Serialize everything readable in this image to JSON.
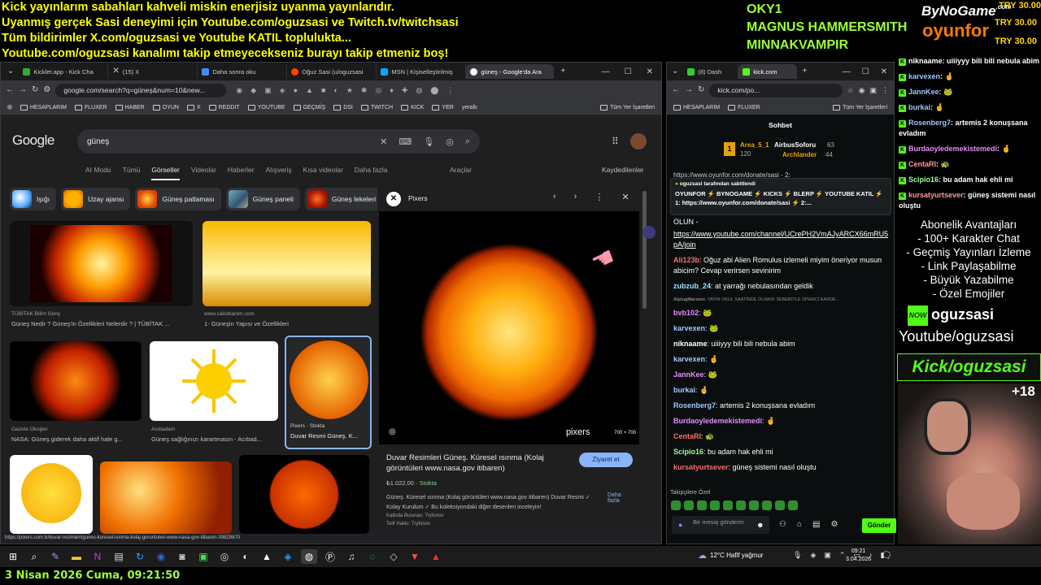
{
  "overlay": {
    "banner_lines": [
      "Kick yayınlarım sabahları kahveli miskin enerjisiz uyanma yayınlarıdır.",
      "Uyanmış gerçek Sasi deneyimi için Youtube.com/oguzsasi ve Twitch.tv/twitchsasi",
      "Tüm bildirimler X.com/oguzsasi ve Youtube KATIL toplulukta...",
      "Youtube.com/oguzsasi kanalımı takip etmeyecekseniz burayı takip etmeniz boş!"
    ],
    "supporters": [
      "OKY1",
      "MAGNUS HAMMERSMITH",
      "MINNAKVAMPIR"
    ],
    "brand_top": "ByNoGame",
    "brand_top_small": ".com",
    "brand_bottom": "oyunfor",
    "donations": [
      "TRY 30.00",
      "TRY 30.00",
      "TRY 30.00"
    ],
    "perks_title": "Abonelik Avantajları",
    "perks": [
      "- 100+ Karakter Chat",
      "- Geçmiş Yayınları İzleme",
      "- Link Paylaşabilme",
      "- Büyük Yazabilme",
      "- Özel Emojiler"
    ],
    "now_badge": "NOW",
    "now_name": "oguzsasi",
    "youtube_text": "Youtube/oguzsasi",
    "kick_text": "Kick/oguzsasi",
    "cam_count": "+18",
    "datetime": "3 Nisan 2026 Cuma, 09:21:50"
  },
  "right_chat": [
    {
      "user": "niknaame",
      "text": ": uiiiyyy bili bili nebula abim",
      "color": "#ffffff"
    },
    {
      "user": "karvexen",
      "text": ": 🤞",
      "color": "#a0c8ff"
    },
    {
      "user": "JannKee",
      "text": ": 🐸",
      "color": "#a0c8ff"
    },
    {
      "user": "burkai",
      "text": ": 🤞",
      "color": "#a0c8ff"
    },
    {
      "user": "Rosenberg7",
      "text": ": artemis 2 konuşsana evladım",
      "color": "#a0c8ff"
    },
    {
      "user": "Burdaoyledemekistemedi",
      "text": ": 🤞",
      "color": "#e58cff"
    },
    {
      "user": "CentaRI",
      "text": ": 🐢",
      "color": "#ff9a9a"
    },
    {
      "user": "Scipio16",
      "text": ": bu adam hak ehli mi",
      "color": "#9cff9c"
    },
    {
      "user": "kursatyurtsever",
      "text": ": güneş sistemi nasıl oluştu",
      "color": "#ff9a9a"
    }
  ],
  "browser": {
    "tabs": [
      "Kicklet.app - Kick Cha",
      "(15) X",
      "Daha sonra oku",
      "Oğuz Sasi (u/oguzsasi",
      "MSN | Kişiselleştirilmiş",
      "güneş - Google'da Ara"
    ],
    "url": "google.com/search?q=güneş&num=10&new...",
    "bookmarks": [
      "HESAPLARIM",
      "FLUXER",
      "HABER",
      "OYUN",
      "X",
      "REDDIT",
      "YOUTUBE",
      "GEÇMİŞ",
      "DSİ",
      "TWITCH",
      "KICK",
      "YER",
      "yeraltı"
    ],
    "all_bookmarks": "Tüm Yer İşaretleri",
    "google_logo": "Google",
    "query": "güneş",
    "nav": [
      "AI Modu",
      "Tümü",
      "Görseller",
      "Videolar",
      "Haberler",
      "Alışveriş",
      "Kısa videolar",
      "Daha fazla"
    ],
    "tools": "Araçlar",
    "saved": "Kaydedilenler",
    "chips": [
      "Işığı",
      "Uzay ajansı",
      "Güneş patlaması",
      "Güneş paneli",
      "Güneş lekeleri"
    ],
    "results": [
      {
        "source": "TÜBİTAK Bilim Genç",
        "title": "Güneş Nedir ? Güneş'in Özellikleri Nelerdir ? | TÜBİTAK ..."
      },
      {
        "source": "www.calistkanim.com",
        "title": "1- Güneşin Yapısı ve Özellikleri"
      },
      {
        "source": "Gazete Oksijen",
        "title": "NASA: Güneş giderek daha aktif hale g..."
      },
      {
        "source": "Acıbadem",
        "title": "Güneş sağlığınızı karartmasın - Acıbad..."
      },
      {
        "source": "Pixers · Stokta",
        "title": "Duvar Resmi Güneş. K..."
      }
    ],
    "status_url": "https://pixers.com.tr/duvar-resimleri/gunes-kuresel-isinma-kolaj-goruntuleri-www-nasa-gov-itibaren-39829870",
    "panel": {
      "site": "Pixers",
      "image_size": "700 × 700",
      "watermark": "pixers",
      "title": "Duvar Resimleri Güneş. Küresel ısınma (Kolaj görüntüleri www.nasa.gov itibaren)",
      "visit": "Ziyaret et",
      "price": "₺1.022,00",
      "stock": "Stokta",
      "desc": "Güneş. Küresel ısınma (Kolaj görüntüleri www.nasa.gov itibaren) Duvar Resmi ✓ Kolay Kurulum ✓ Bu koleksiyondaki diğer desenleri inceleyin!",
      "more": "Daha fazla",
      "uploader": "Katkıda Bulunan: Tryfonov",
      "copyright": "Telif Hakkı: Tryfonov"
    }
  },
  "kick_window": {
    "tabs": [
      "(8) Dash",
      "kick.com"
    ],
    "url": "kick.com/po...",
    "bookmarks": [
      "HESAPLARIM",
      "FLUXER"
    ],
    "all_bookmarks": "Tüm Yer İşaretleri",
    "chat_title": "Sohbet",
    "leaderboard": [
      {
        "name": "Area_5_1",
        "value": "120"
      },
      {
        "name": "AirbusSoforu",
        "value": "63"
      },
      {
        "name": "Archlander",
        "value": "44"
      }
    ],
    "pinned_url_top": "https://www.oyunfor.com/donate/sasi - 2:",
    "pinned_by": "oguzsasi tarafından sabitlendi",
    "pinned_text": "OYUNFOR ⚡ BYNOGAME ⚡ KICKS ⚡ BLERP ⚡ YOUTUBE KATIL ⚡ 1: https://www.oyunfor.com/donate/sasi ⚡ 2:...",
    "lead_text": "OLUN -",
    "lead_link": "https://www.youtube.com/channel/UCrePH2VmAJyARCX66mRU5pA/join",
    "messages": [
      {
        "user": "Ali123b",
        "text": ": Oğuz abi Alien Romulus izlemeli miyim öneriyor musun abicim? Cevap verirsen sevinirim",
        "color": "#ff6b6b"
      },
      {
        "user": "zubzub_24",
        "text": ": at yarrağı nebulasından geldik",
        "color": "#9ce5ff"
      },
      {
        "user": "AlptugMarston",
        "text": ": YAYIN OKUL SAATİNDE OLMASI SEBEBİYLE SPEMCİ KARDE...",
        "color": "#888888"
      },
      {
        "user": "bvb102",
        "text": ": 🐸",
        "color": "#e58cff"
      },
      {
        "user": "karvexen",
        "text": ": 🐸",
        "color": "#a0c8ff"
      },
      {
        "user": "niknaame",
        "text": ": uiiiyyy bili bili nebula abim",
        "color": "#ffffff"
      },
      {
        "user": "karvexen",
        "text": ": 🤞",
        "color": "#a0c8ff"
      },
      {
        "user": "JannKee",
        "text": ": 🐸",
        "color": "#e58cff"
      },
      {
        "user": "burkai",
        "text": ": 🤞",
        "color": "#a0c8ff"
      },
      {
        "user": "Rosenberg7",
        "text": ": artemis 2 konuşsana evladım",
        "color": "#a0c8ff"
      },
      {
        "user": "Burdaoyledemekistemedi",
        "text": ": 🤞",
        "color": "#e58cff"
      },
      {
        "user": "CentaRI",
        "text": ": 🐢",
        "color": "#ff6b6b"
      },
      {
        "user": "Scipio16",
        "text": ": bu adam hak ehli mi",
        "color": "#9cff9c"
      },
      {
        "user": "kursatyurtsever",
        "text": ": güneş sistemi nasıl oluştu",
        "color": "#ff6b6b"
      }
    ],
    "followers_label": "Takipçilere Özel",
    "input_placeholder": "Bir mesaj gönderin",
    "send": "Gönder"
  },
  "taskbar": {
    "weather": "12°C",
    "weather_desc": "Hafif yağmur",
    "time": "09:21",
    "date": "3.04.2026"
  }
}
